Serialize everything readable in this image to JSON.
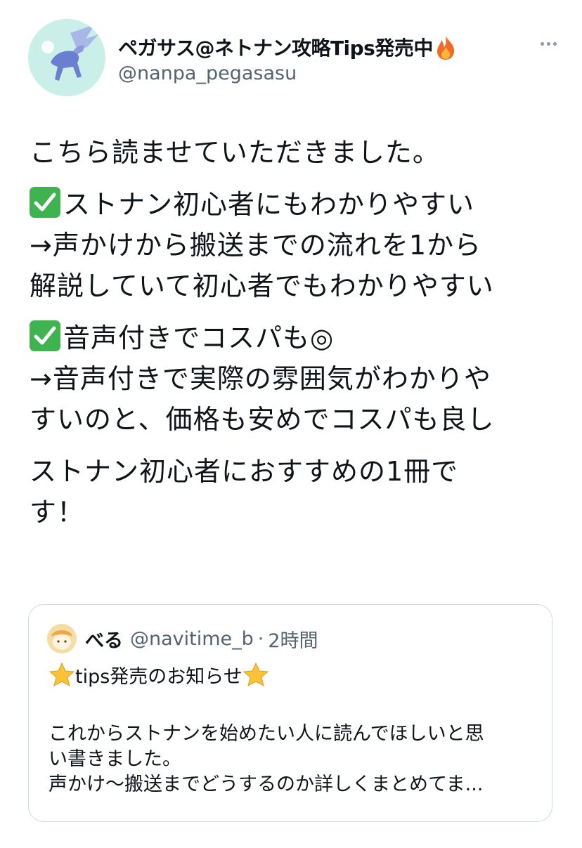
{
  "user": {
    "display_name": "ペガサス@ネトナン攻略Tips発売中",
    "name_suffix_icon": "fire-icon",
    "handle": "@nanpa_pegasasu",
    "avatar": "pegasus-avatar"
  },
  "more_icon": "more-horizontal-icon",
  "tweet": {
    "intro": "こちら読ませていただきました。",
    "point1_title": "ストナン初心者にもわかりやすい",
    "point1_desc_lines": [
      "→声かけから搬送までの流れを1から",
      "解説していて初心者でもわかりやすい"
    ],
    "point2_title": "音声付きでコスパも◎",
    "point2_desc_lines": [
      "→音声付きで実際の雰囲気がわかりや",
      "すいのと、価格も安めでコスパも良し"
    ],
    "closing_lines": [
      "ストナン初心者におすすめの1冊で",
      "す！"
    ],
    "check_icon": "check-mark-icon"
  },
  "quote": {
    "name": "べる",
    "handle": "@navitime_b",
    "separator": "·",
    "time": "2時間",
    "title": "tips発売のお知らせ",
    "title_icon": "star-icon",
    "body_lines": [
      "これからストナンを始めたい人に読んでほしいと思",
      "い書きました。",
      "声かけ〜搬送までどうするのか詳しくまとめてま..."
    ]
  },
  "colors": {
    "text": "#0f1419",
    "secondary": "#536471",
    "border": "#cfd9de",
    "check_green": "#3fb350",
    "star_yellow": "#f8c338"
  }
}
